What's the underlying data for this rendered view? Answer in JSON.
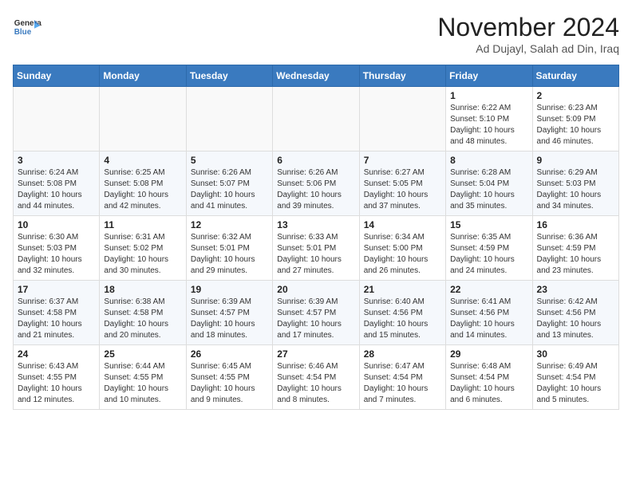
{
  "header": {
    "logo_line1": "General",
    "logo_line2": "Blue",
    "month": "November 2024",
    "location": "Ad Dujayl, Salah ad Din, Iraq"
  },
  "days_of_week": [
    "Sunday",
    "Monday",
    "Tuesday",
    "Wednesday",
    "Thursday",
    "Friday",
    "Saturday"
  ],
  "weeks": [
    [
      null,
      null,
      null,
      null,
      null,
      {
        "day": 1,
        "sunrise": "6:22 AM",
        "sunset": "5:10 PM",
        "daylight": "10 hours and 48 minutes."
      },
      {
        "day": 2,
        "sunrise": "6:23 AM",
        "sunset": "5:09 PM",
        "daylight": "10 hours and 46 minutes."
      }
    ],
    [
      {
        "day": 3,
        "sunrise": "6:24 AM",
        "sunset": "5:08 PM",
        "daylight": "10 hours and 44 minutes."
      },
      {
        "day": 4,
        "sunrise": "6:25 AM",
        "sunset": "5:08 PM",
        "daylight": "10 hours and 42 minutes."
      },
      {
        "day": 5,
        "sunrise": "6:26 AM",
        "sunset": "5:07 PM",
        "daylight": "10 hours and 41 minutes."
      },
      {
        "day": 6,
        "sunrise": "6:26 AM",
        "sunset": "5:06 PM",
        "daylight": "10 hours and 39 minutes."
      },
      {
        "day": 7,
        "sunrise": "6:27 AM",
        "sunset": "5:05 PM",
        "daylight": "10 hours and 37 minutes."
      },
      {
        "day": 8,
        "sunrise": "6:28 AM",
        "sunset": "5:04 PM",
        "daylight": "10 hours and 35 minutes."
      },
      {
        "day": 9,
        "sunrise": "6:29 AM",
        "sunset": "5:03 PM",
        "daylight": "10 hours and 34 minutes."
      }
    ],
    [
      {
        "day": 10,
        "sunrise": "6:30 AM",
        "sunset": "5:03 PM",
        "daylight": "10 hours and 32 minutes."
      },
      {
        "day": 11,
        "sunrise": "6:31 AM",
        "sunset": "5:02 PM",
        "daylight": "10 hours and 30 minutes."
      },
      {
        "day": 12,
        "sunrise": "6:32 AM",
        "sunset": "5:01 PM",
        "daylight": "10 hours and 29 minutes."
      },
      {
        "day": 13,
        "sunrise": "6:33 AM",
        "sunset": "5:01 PM",
        "daylight": "10 hours and 27 minutes."
      },
      {
        "day": 14,
        "sunrise": "6:34 AM",
        "sunset": "5:00 PM",
        "daylight": "10 hours and 26 minutes."
      },
      {
        "day": 15,
        "sunrise": "6:35 AM",
        "sunset": "4:59 PM",
        "daylight": "10 hours and 24 minutes."
      },
      {
        "day": 16,
        "sunrise": "6:36 AM",
        "sunset": "4:59 PM",
        "daylight": "10 hours and 23 minutes."
      }
    ],
    [
      {
        "day": 17,
        "sunrise": "6:37 AM",
        "sunset": "4:58 PM",
        "daylight": "10 hours and 21 minutes."
      },
      {
        "day": 18,
        "sunrise": "6:38 AM",
        "sunset": "4:58 PM",
        "daylight": "10 hours and 20 minutes."
      },
      {
        "day": 19,
        "sunrise": "6:39 AM",
        "sunset": "4:57 PM",
        "daylight": "10 hours and 18 minutes."
      },
      {
        "day": 20,
        "sunrise": "6:39 AM",
        "sunset": "4:57 PM",
        "daylight": "10 hours and 17 minutes."
      },
      {
        "day": 21,
        "sunrise": "6:40 AM",
        "sunset": "4:56 PM",
        "daylight": "10 hours and 15 minutes."
      },
      {
        "day": 22,
        "sunrise": "6:41 AM",
        "sunset": "4:56 PM",
        "daylight": "10 hours and 14 minutes."
      },
      {
        "day": 23,
        "sunrise": "6:42 AM",
        "sunset": "4:56 PM",
        "daylight": "10 hours and 13 minutes."
      }
    ],
    [
      {
        "day": 24,
        "sunrise": "6:43 AM",
        "sunset": "4:55 PM",
        "daylight": "10 hours and 12 minutes."
      },
      {
        "day": 25,
        "sunrise": "6:44 AM",
        "sunset": "4:55 PM",
        "daylight": "10 hours and 10 minutes."
      },
      {
        "day": 26,
        "sunrise": "6:45 AM",
        "sunset": "4:55 PM",
        "daylight": "10 hours and 9 minutes."
      },
      {
        "day": 27,
        "sunrise": "6:46 AM",
        "sunset": "4:54 PM",
        "daylight": "10 hours and 8 minutes."
      },
      {
        "day": 28,
        "sunrise": "6:47 AM",
        "sunset": "4:54 PM",
        "daylight": "10 hours and 7 minutes."
      },
      {
        "day": 29,
        "sunrise": "6:48 AM",
        "sunset": "4:54 PM",
        "daylight": "10 hours and 6 minutes."
      },
      {
        "day": 30,
        "sunrise": "6:49 AM",
        "sunset": "4:54 PM",
        "daylight": "10 hours and 5 minutes."
      }
    ]
  ]
}
